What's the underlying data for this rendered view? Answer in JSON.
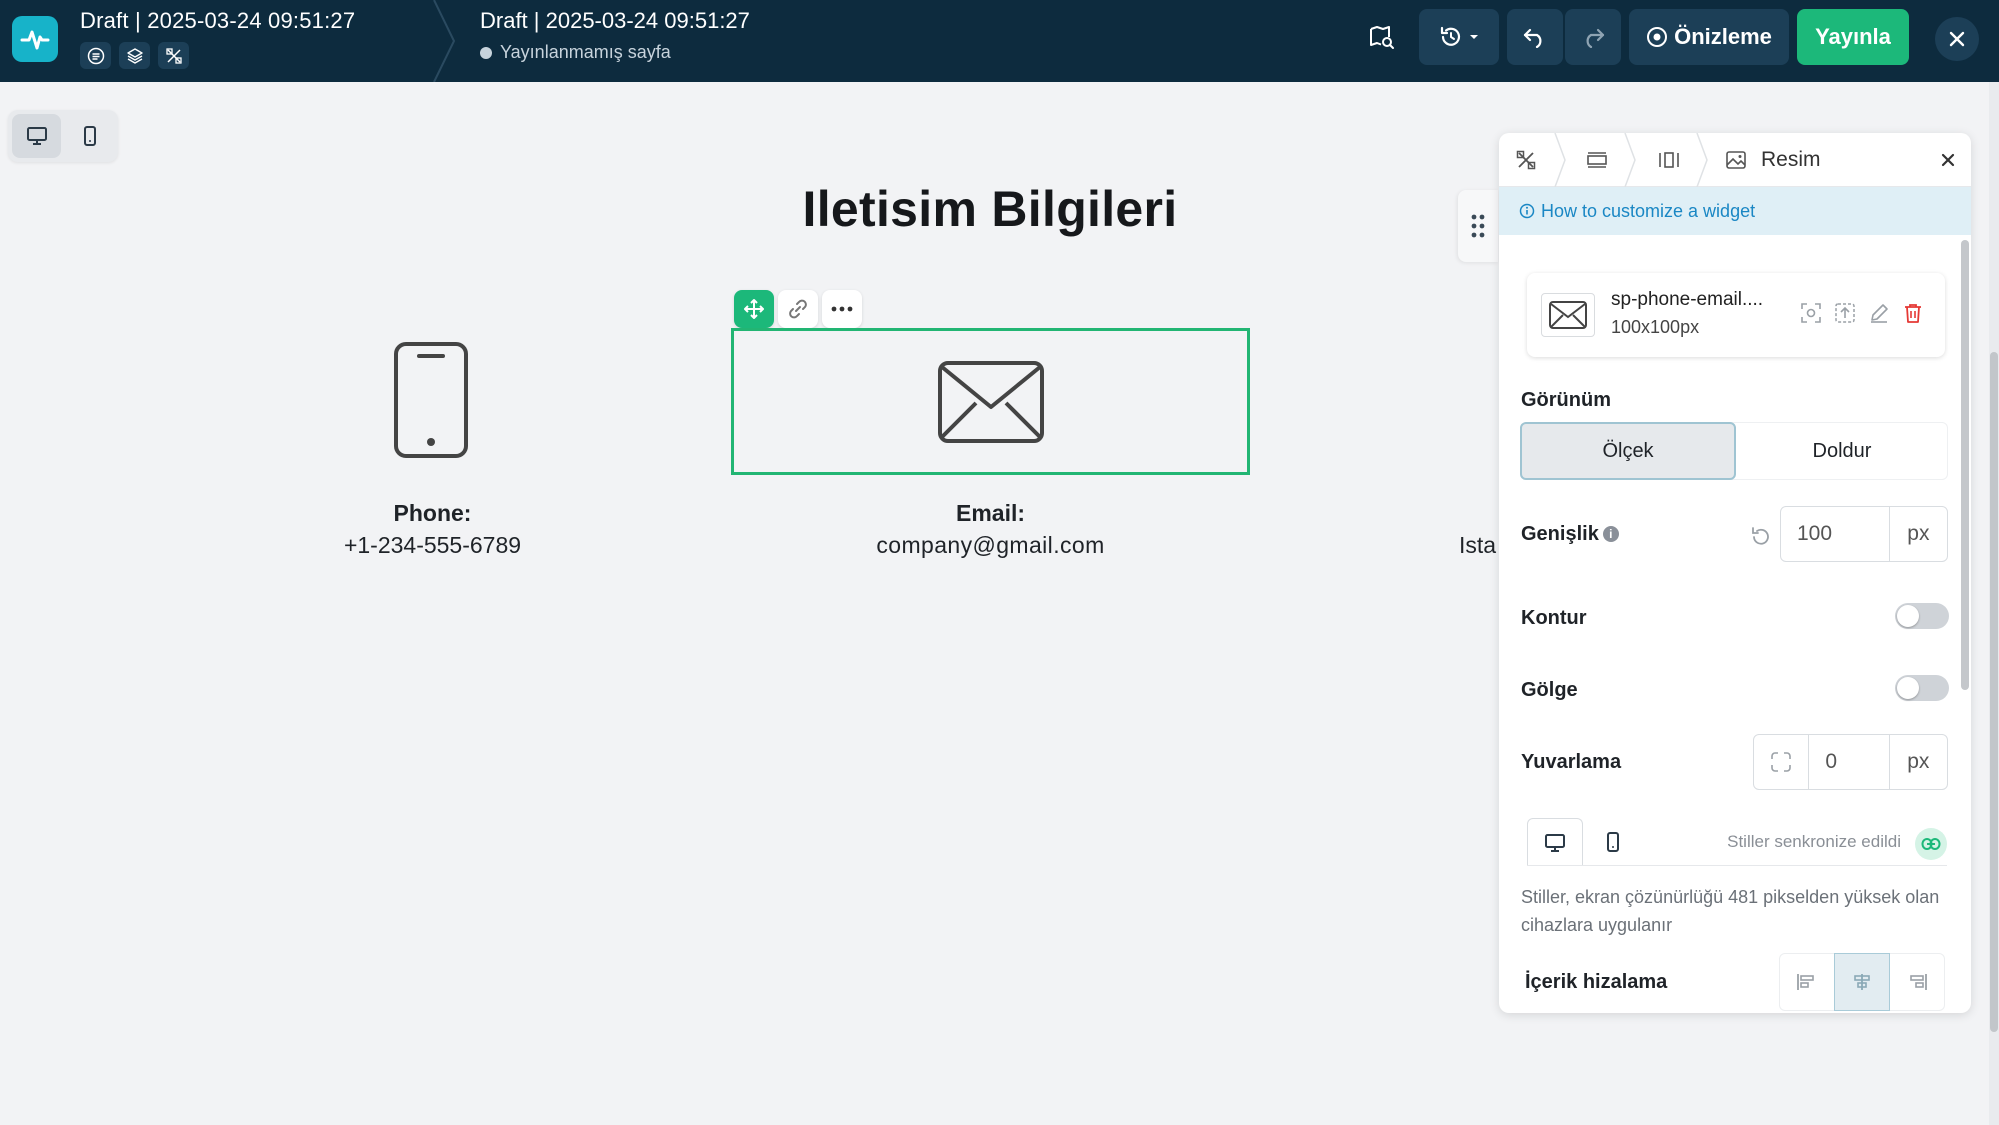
{
  "topbar": {
    "draft_title_left": "Draft | 2025-03-24 09:51:27",
    "draft_title_right": "Draft | 2025-03-24 09:51:27",
    "status": "Yayınlanmamış sayfa",
    "preview_label": "Önizleme",
    "publish_label": "Yayınla"
  },
  "page": {
    "title": "Iletisim Bilgileri",
    "phone_label": "Phone:",
    "phone_value": "+1-234-555-6789",
    "email_label": "Email:",
    "email_value": "company@gmail.com",
    "address_partial": "Ista"
  },
  "panel": {
    "title": "Resim",
    "help_link": "How to customize a widget",
    "image": {
      "name": "sp-phone-email....",
      "size": "100x100px"
    },
    "appearance_label": "Görünüm",
    "appearance_options": [
      "Ölçek",
      "Doldur"
    ],
    "width_label": "Genişlik",
    "width_value": "100",
    "width_unit": "px",
    "border_label": "Kontur",
    "shadow_label": "Gölge",
    "radius_label": "Yuvarlama",
    "radius_value": "0",
    "radius_unit": "px",
    "sync_text": "Stiller senkronize edildi",
    "description": "Stiller, ekran çözünürlüğü 481 pikselden yüksek olan cihazlara uygulanır",
    "content_align_label": "İçerik hizalama"
  },
  "colors": {
    "topbar": "#0d2b3e",
    "accent_green": "#1cb87a",
    "selection_border": "#22b573",
    "help_link": "#1a87c4",
    "delete_red": "#e53935"
  }
}
